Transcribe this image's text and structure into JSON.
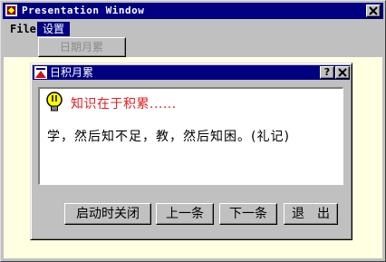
{
  "window": {
    "title": "Presentation Window"
  },
  "menu": {
    "file": "File",
    "settings": "设置",
    "dropdown_item": "日期月累"
  },
  "dialog": {
    "title": "日积月累",
    "help": "?",
    "headline": "知识在于积累......",
    "quote": "学，然后知不足，教，然后知困。(礼记)",
    "buttons": {
      "close_on_start": "启动时关闭",
      "prev": "上一条",
      "next": "下一条",
      "exit": "退　出"
    }
  }
}
